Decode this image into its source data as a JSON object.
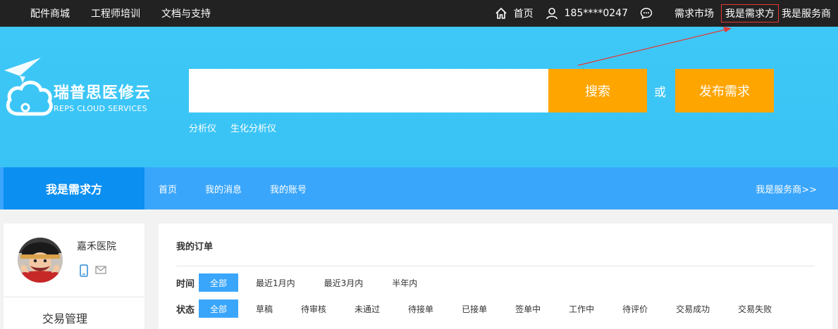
{
  "topbar": {
    "left_links": [
      "配件商城",
      "工程师培训",
      "文档与支持"
    ],
    "home": "首页",
    "phone": "185****0247",
    "market": "需求市场",
    "requester": "我是需求方",
    "provider": "我是服务商"
  },
  "hero": {
    "logo_cn": "瑞普思医修云",
    "logo_en": "REPS CLOUD SERVICES",
    "search_placeholder": "",
    "search_button": "搜索",
    "or": "或",
    "publish_button": "发布需求",
    "hot_keywords": [
      "分析仪",
      "生化分析仪"
    ]
  },
  "nav": {
    "title": "我是需求方",
    "links": [
      "首页",
      "我的消息",
      "我的账号"
    ],
    "right": "我是服务商>>"
  },
  "sidebar": {
    "user_name": "嘉禾医院",
    "section_heading": "交易管理"
  },
  "main": {
    "title": "我的订单",
    "time_label": "时间",
    "time_filters": [
      "全部",
      "最近1月内",
      "最近3月内",
      "半年内"
    ],
    "status_label": "状态",
    "status_filters": [
      "全部",
      "草稿",
      "待审核",
      "未通过",
      "待接单",
      "已接单",
      "签单中",
      "工作中",
      "待评价",
      "交易成功",
      "交易失败"
    ]
  },
  "colors": {
    "topbar_bg": "#222222",
    "hero_bg": "#3ec8f7",
    "accent_orange": "#ffa500",
    "nav_bg": "#3aa6fb",
    "nav_title_bg": "#0b8ff1",
    "chip_active": "#3aa6fb",
    "highlight_red": "#e53935"
  }
}
